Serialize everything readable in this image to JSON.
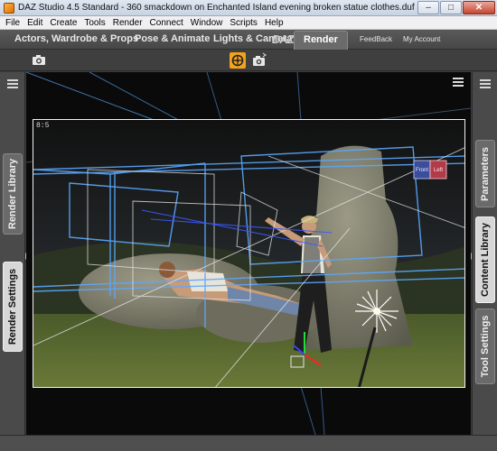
{
  "window": {
    "title": "DAZ Studio 4.5 Standard - 360 smackdown on Enchanted Island evening broken statue clothes.duf",
    "minimize": "–",
    "maximize": "□",
    "close": "✕"
  },
  "menu": [
    "File",
    "Edit",
    "Create",
    "Tools",
    "Render",
    "Connect",
    "Window",
    "Scripts",
    "Help"
  ],
  "tabs": {
    "main": [
      "Actors, Wardrobe & Props",
      "Pose & Animate",
      "Lights & Camera",
      "Render"
    ],
    "active": "Render",
    "logo": "DAZ",
    "links": [
      "FeedBack",
      "My Account"
    ]
  },
  "left_panel": {
    "tabs": [
      "Render Library",
      "Render Settings"
    ],
    "active": "Render Settings"
  },
  "right_panel": {
    "tabs": [
      "Parameters",
      "Content Library",
      "Tool Settings"
    ],
    "active": "Content Library"
  },
  "viewport": {
    "aspect_ratio": "8:5",
    "cube_labels": [
      "Front",
      "Left"
    ]
  },
  "icons": {
    "left_toolbar": "camera-icon",
    "render": "render-icon",
    "camera": "camera-icon"
  },
  "colors": {
    "accent": "#f3a21b",
    "guide_blue": "#5aa8ff",
    "background": "#3c3c3c"
  }
}
